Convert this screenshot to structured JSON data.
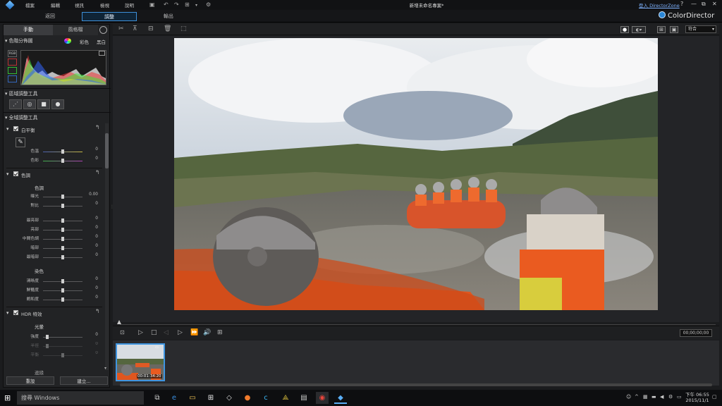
{
  "titlebar": {
    "menus": [
      "檔案",
      "編輯",
      "視訊",
      "檢視",
      "說明"
    ],
    "project_name": "新增未命名專案*",
    "login_link": "登入 DirectorZone",
    "help": "?",
    "minimize": "—",
    "restore": "⧉",
    "close": "✕"
  },
  "modes": {
    "back": "返回",
    "adjust": "調整",
    "output": "輸出"
  },
  "brand": {
    "name": "ColorDirector"
  },
  "left_panel": {
    "tabs": {
      "manual": "手動",
      "style": "風格檔"
    },
    "histogram": {
      "title": "色階分佈圖",
      "color": "彩色",
      "bw": "黑白",
      "rgb_label": "RGB"
    },
    "regional_tools": {
      "title": "區域調整工具"
    },
    "global_tools": {
      "title": "全域調整工具"
    },
    "white_balance": {
      "title": "白平衡",
      "sliders": [
        {
          "label": "色溫",
          "value": "0"
        },
        {
          "label": "色彩",
          "value": "0"
        }
      ]
    },
    "tone": {
      "title": "色調",
      "subtitle": "色調",
      "sliders1": [
        {
          "label": "曝光",
          "value": "0.00"
        },
        {
          "label": "對比",
          "value": "0"
        }
      ],
      "sliders2": [
        {
          "label": "最亮部",
          "value": "0"
        },
        {
          "label": "亮部",
          "value": "0"
        },
        {
          "label": "中間色調",
          "value": "0"
        },
        {
          "label": "暗部",
          "value": "0"
        },
        {
          "label": "最暗部",
          "value": "0"
        }
      ],
      "subtitle2": "染色",
      "sliders3": [
        {
          "label": "清晰度",
          "value": "0"
        },
        {
          "label": "鮮豔度",
          "value": "0"
        },
        {
          "label": "飽和度",
          "value": "0"
        }
      ]
    },
    "hdr": {
      "title": "HDR 特效",
      "subtitle": "光暈",
      "sliders": [
        {
          "label": "強度",
          "value": "0"
        },
        {
          "label": "半徑",
          "value": "0"
        },
        {
          "label": "平衡",
          "value": "0"
        }
      ],
      "next_subtitle": "邊緣"
    },
    "buttons": {
      "reset": "重設",
      "create": "建立..."
    }
  },
  "preview_toolbar": {
    "fit": "符合"
  },
  "playback": {
    "timecode": "00;00;00;00"
  },
  "clip": {
    "timecode": "00:01:34:20"
  },
  "taskbar": {
    "search_placeholder": "搜尋 Windows",
    "time": "下午 06:55",
    "date": "2015/11/1"
  },
  "colors": {
    "accent": "#3d8fd8",
    "brand": "#2a86d6"
  }
}
